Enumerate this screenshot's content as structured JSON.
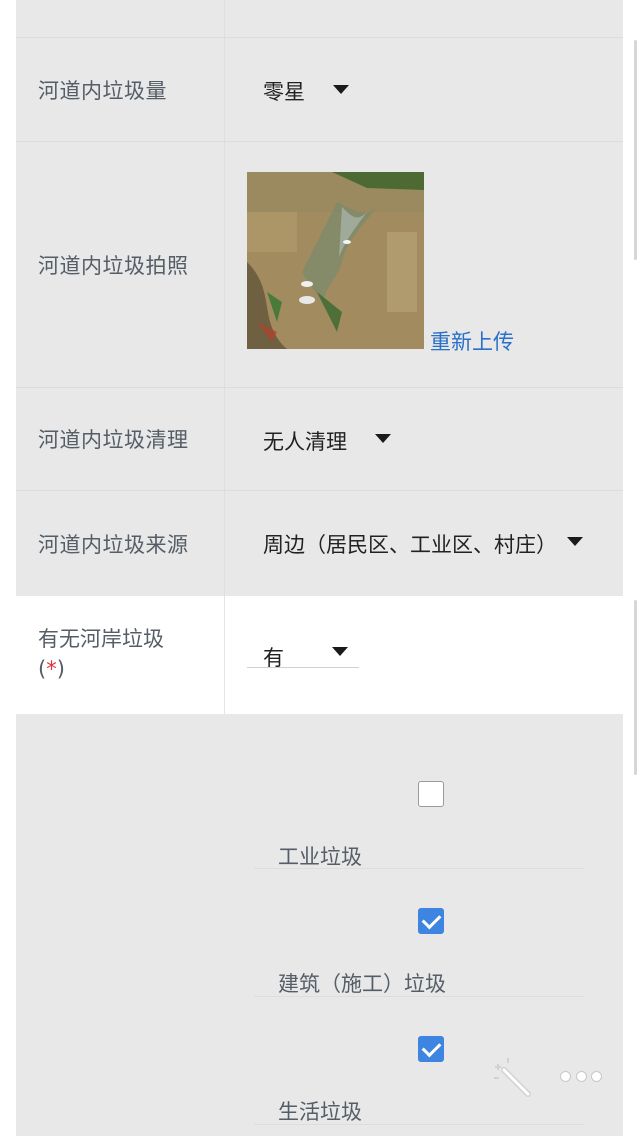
{
  "form": {
    "trash_amount": {
      "label": "河道内垃圾量",
      "value": "零星"
    },
    "trash_photo": {
      "label": "河道内垃圾拍照",
      "reupload": "重新上传"
    },
    "trash_cleanup": {
      "label": "河道内垃圾清理",
      "value": "无人清理"
    },
    "trash_source": {
      "label": "河道内垃圾来源",
      "value": "周边（居民区、工业区、村庄）"
    },
    "bank_trash": {
      "label": "有无河岸垃圾",
      "required_open": "(",
      "required_mark": "*",
      "required_close": ")",
      "value": "有"
    },
    "bank_trash_types": [
      {
        "label": "工业垃圾",
        "checked": false
      },
      {
        "label": "建筑（施工）垃圾",
        "checked": true
      },
      {
        "label": "生活垃圾",
        "checked": true
      }
    ]
  },
  "icons": {
    "magic_wand": "magic-wand-icon",
    "more": "more-dots-icon"
  },
  "colors": {
    "accent": "#3d85e0",
    "link": "#2a6fc9",
    "required": "#e0323c"
  }
}
